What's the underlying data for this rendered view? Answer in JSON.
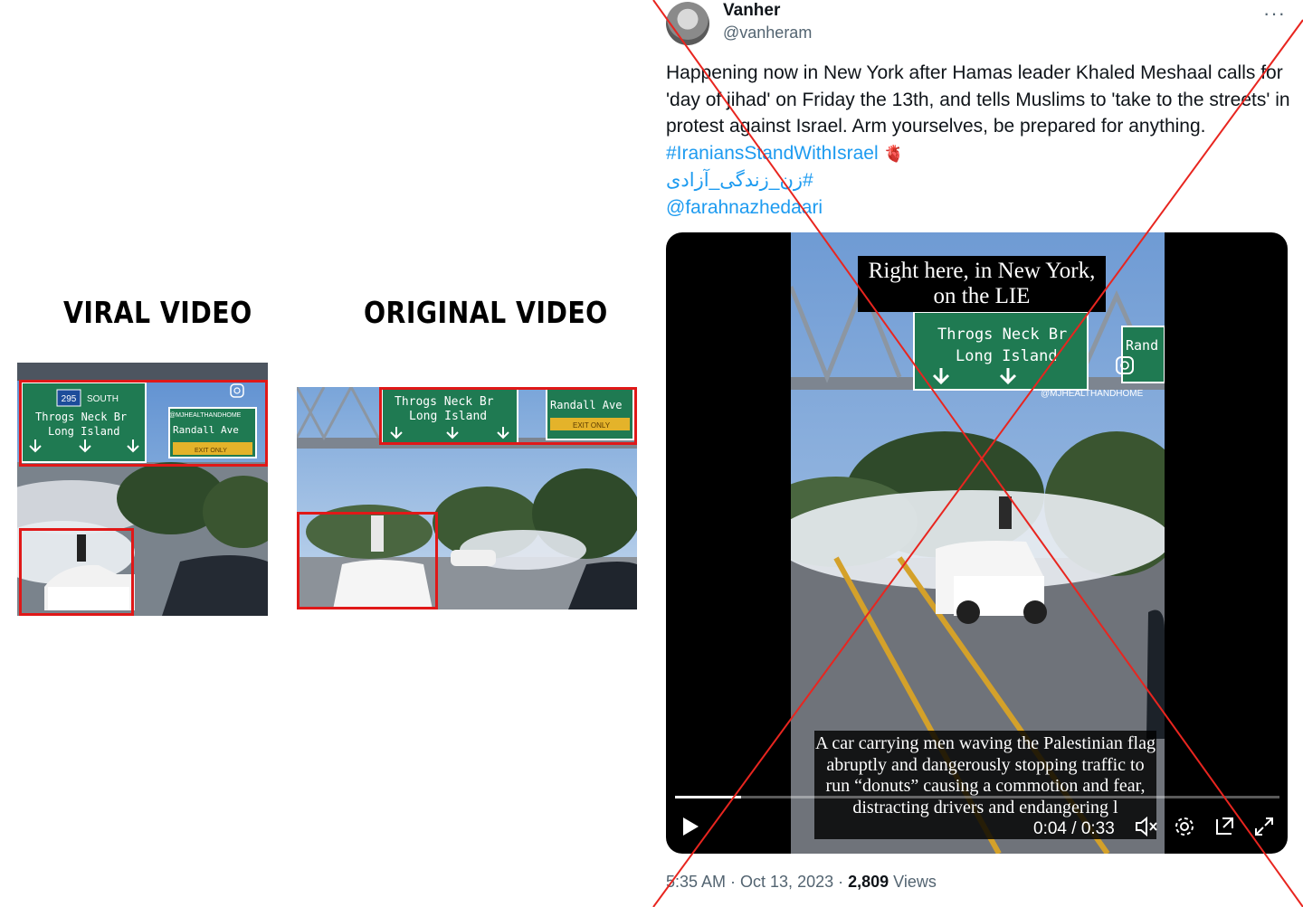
{
  "comparison": {
    "viral_title": "VIRAL VIDEO",
    "original_title": "ORIGINAL VIDEO",
    "viral_frame": {
      "route_shield": "295",
      "route_direction": "SOUTH",
      "sign_main_line1": "Throgs Neck Br",
      "sign_main_line2": "Long Island",
      "sign_right": "Randall Ave",
      "sign_right_sub": "EXIT ONLY",
      "watermark": "@MJHEALTHANDHOME"
    },
    "original_frame": {
      "sign_main_line1": "Throgs Neck Br",
      "sign_main_line2": "Long Island",
      "sign_right": "Randall Ave",
      "sign_right_sub": "EXIT ONLY"
    },
    "colors": {
      "highlight": "#e01818"
    }
  },
  "tweet": {
    "author": {
      "display_name": "Vanher",
      "handle": "@vanheram"
    },
    "more_label": "···",
    "body": "Happening now in New York after Hamas leader Khaled Meshaal calls for 'day of jihad' on Friday the 13th, and tells Muslims to 'take to the streets' in protest against Israel. Arm yourselves, be prepared for anything.",
    "hashtag_1": "#IraniansStandWithIsrael",
    "heart": "🫀",
    "hashtag_2": "#زن_زندگی_آزادی",
    "mention": "@farahnazhedaari",
    "video": {
      "caption_top": "Right here, in New York, on the LIE",
      "caption_bottom": "A car carrying men waving the Palestinian flag abruptly and dangerously stopping  traffic to run “donuts” causing a commotion and fear, distracting drivers and endangering l",
      "sign_main_line1": "Throgs Neck Br",
      "sign_main_line2": "Long Island",
      "sign_right": "Rand",
      "watermark": "@MJHEALTHANDHOME",
      "current_time": "0:04",
      "duration": "0:33",
      "time_display": "0:04 / 0:33",
      "progress_fraction": 0.11
    },
    "timestamp": "5:35 AM · Oct 13, 2023 · ",
    "views_count": "2,809",
    "views_label": " Views"
  },
  "overlay": {
    "cross_color": "#e8251f"
  }
}
